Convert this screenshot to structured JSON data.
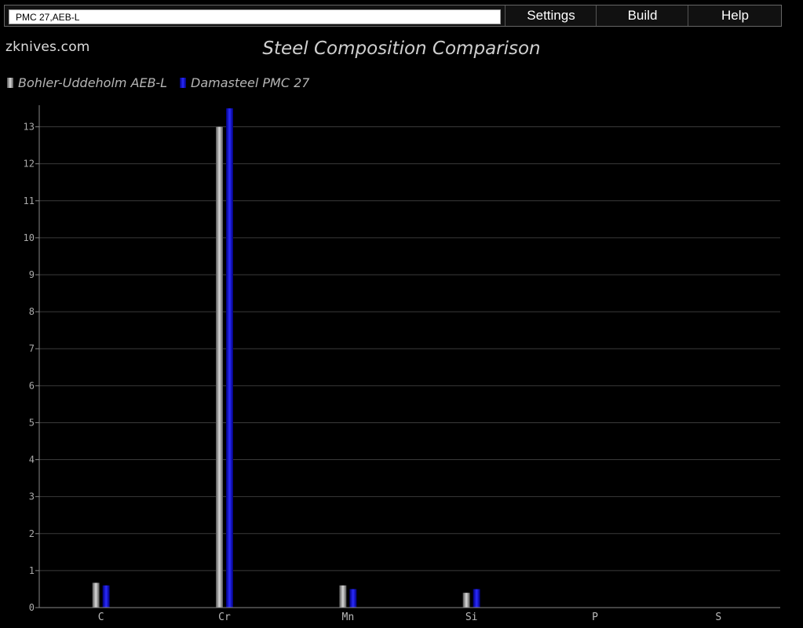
{
  "header": {
    "search_value": "PMC 27,AEB-L",
    "menu": [
      "Settings",
      "Build",
      "Help"
    ]
  },
  "logo_text": "zknives.com",
  "chart_data": {
    "type": "bar",
    "title": "Steel Composition Comparison",
    "categories": [
      "C",
      "Cr",
      "Mn",
      "Si",
      "P",
      "S"
    ],
    "series": [
      {
        "name": "Bohler-Uddeholm AEB-L",
        "color": "#9a9a9a",
        "values": [
          0.67,
          13.0,
          0.6,
          0.4,
          0,
          0
        ]
      },
      {
        "name": "Damasteel PMC 27",
        "color": "#1212d8",
        "values": [
          0.6,
          13.5,
          0.5,
          0.5,
          0,
          0
        ]
      }
    ],
    "yticks": [
      0,
      1,
      2,
      3,
      4,
      5,
      6,
      7,
      8,
      9,
      10,
      11,
      12,
      13
    ],
    "ylim": [
      0,
      13.5
    ],
    "legend_position": "top-left",
    "grid": true
  }
}
